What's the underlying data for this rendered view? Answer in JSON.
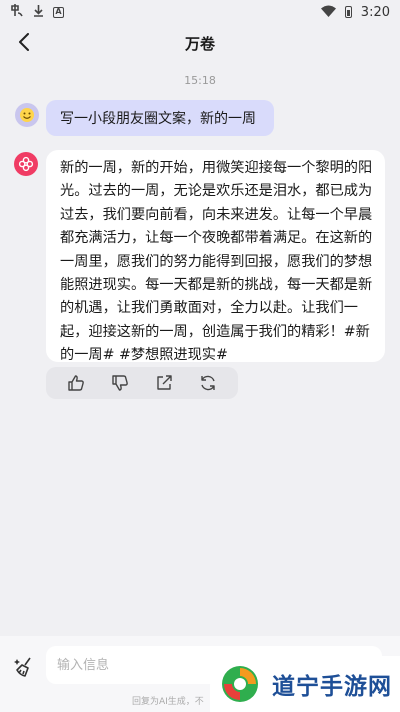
{
  "status_bar": {
    "time": "3:20",
    "left_icons": [
      "app-notification-icon",
      "download-icon",
      "image-notification-icon"
    ],
    "right_icons": [
      "wifi-icon",
      "battery-icon"
    ]
  },
  "header": {
    "title": "万卷",
    "back_icon": "chevron-left-icon"
  },
  "chat": {
    "timestamp": "15:18",
    "user_message": "写一小段朋友圈文案，新的一周",
    "bot_message": "新的一周，新的开始，用微笑迎接每一个黎明的阳光。过去的一周，无论是欢乐还是泪水，都已成为过去，我们要向前看，向未来进发。让每一个早晨都充满活力，让每一个夜晚都带着满足。在这新的一周里，愿我们的努力能得到回报，愿我们的梦想能照进现实。每一天都是新的挑战，每一天都是新的机遇，让我们勇敢面对，全力以赴。让我们一起，迎接这新的一周，创造属于我们的精彩！#新的一周# #梦想照进现实#",
    "actions": [
      "thumbs-up-icon",
      "thumbs-down-icon",
      "share-icon",
      "refresh-icon"
    ]
  },
  "input": {
    "placeholder": "输入信息",
    "value": "",
    "disclaimer": "回复为AI生成，不"
  },
  "watermark": {
    "text": "道宁手游网"
  },
  "colors": {
    "background": "#f0f0f3",
    "user_bubble": "#d9dbfb",
    "bot_avatar": "#f03c64",
    "user_avatar": "#c9c6ee",
    "watermark_text": "#1e4f97"
  }
}
